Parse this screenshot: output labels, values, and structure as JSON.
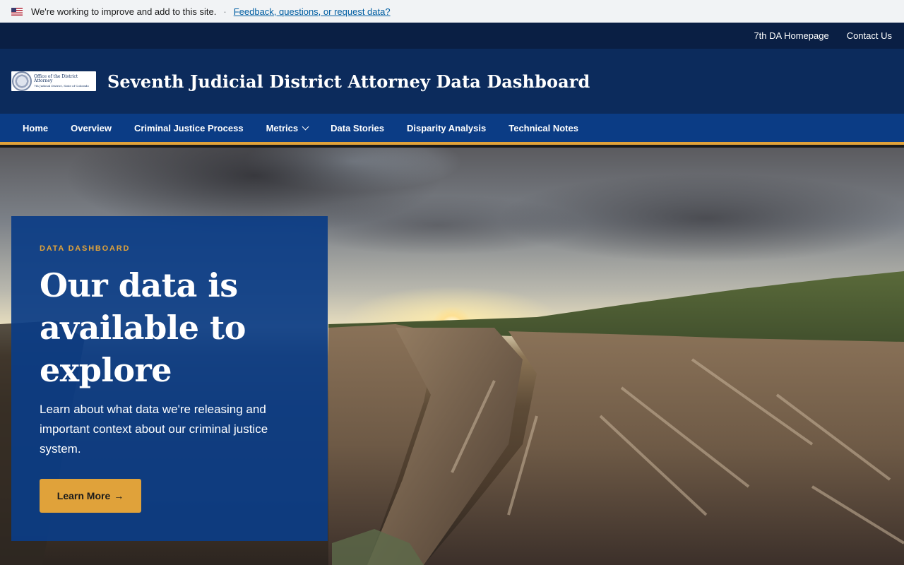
{
  "banner": {
    "text": "We're working to improve and add to this site.",
    "separator": "·",
    "link": "Feedback, questions, or request data?"
  },
  "utility_nav": {
    "homepage": "7th DA Homepage",
    "contact": "Contact Us"
  },
  "header": {
    "seal_line1": "Office of the District Attorney",
    "seal_line2": "7th Judicial District, State of Colorado",
    "title": "Seventh Judicial District Attorney Data Dashboard"
  },
  "main_nav": {
    "items": [
      {
        "label": "Home"
      },
      {
        "label": "Overview"
      },
      {
        "label": "Criminal Justice Process"
      },
      {
        "label": "Metrics"
      },
      {
        "label": "Data Stories"
      },
      {
        "label": "Disparity Analysis"
      },
      {
        "label": "Technical Notes"
      }
    ]
  },
  "hero": {
    "eyebrow": "DATA DASHBOARD",
    "title_line1": "Our data is",
    "title_line2": "available to",
    "title_line3": "explore",
    "description": "Learn about what data we're releasing and important context about our criminal justice system.",
    "cta_label": "Learn More",
    "cta_arrow": "→"
  },
  "colors": {
    "banner_bg": "#f1f3f5",
    "utility_bg": "#0a1f44",
    "header_bg": "#0c2b5c",
    "nav_bg": "#0b3c85",
    "accent": "#e0a23a",
    "link": "#005ea2"
  }
}
